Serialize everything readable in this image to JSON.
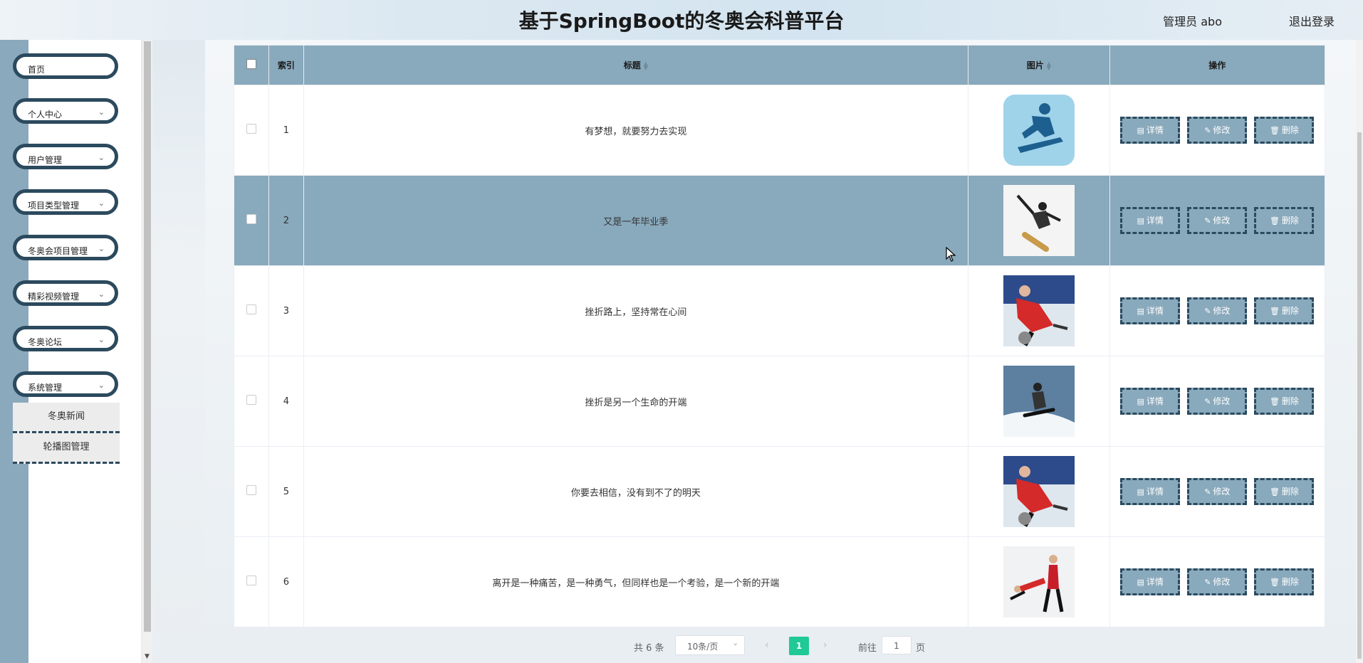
{
  "header": {
    "title": "基于SpringBoot的冬奥会科普平台",
    "user": "管理员 abo",
    "logout": "退出登录"
  },
  "sidebar": {
    "items": [
      {
        "label": "首页",
        "expandable": false
      },
      {
        "label": "个人中心",
        "expandable": true
      },
      {
        "label": "用户管理",
        "expandable": true
      },
      {
        "label": "项目类型管理",
        "expandable": true
      },
      {
        "label": "冬奥会项目管理",
        "expandable": true
      },
      {
        "label": "精彩视频管理",
        "expandable": true
      },
      {
        "label": "冬奥论坛",
        "expandable": true
      },
      {
        "label": "系统管理",
        "expandable": true
      }
    ],
    "sub_items": [
      "冬奥新闻",
      "轮播图管理"
    ]
  },
  "table": {
    "columns": [
      "索引",
      "标题",
      "图片",
      "操作"
    ],
    "rows": [
      {
        "index": "1",
        "title": "有梦想，就要努力去实现",
        "image": "snowboard-logo"
      },
      {
        "index": "2",
        "title": "又是一年毕业季",
        "image": "snowboarder-jump"
      },
      {
        "index": "3",
        "title": "挫折路上，坚持常在心间",
        "image": "curling-player"
      },
      {
        "index": "4",
        "title": "挫折是另一个生命的开端",
        "image": "snowboarder-slope"
      },
      {
        "index": "5",
        "title": "你要去相信，没有到不了的明天",
        "image": "curling-player"
      },
      {
        "index": "6",
        "title": "离开是一种痛苦，是一种勇气，但同样也是一个考验，是一个新的开端",
        "image": "figure-skating-pair"
      }
    ],
    "actions": {
      "detail": "详情",
      "edit": "修改",
      "delete": "删除"
    },
    "hovered_row": 2
  },
  "pagination": {
    "total": "共 6 条",
    "page_size": "10条/页",
    "current_page": "1",
    "goto_label": "前往",
    "goto_value": "1",
    "page_suffix": "页"
  },
  "colors": {
    "accent": "#89a9bc",
    "dark": "#2c4a5e",
    "active_page": "#20c997"
  }
}
